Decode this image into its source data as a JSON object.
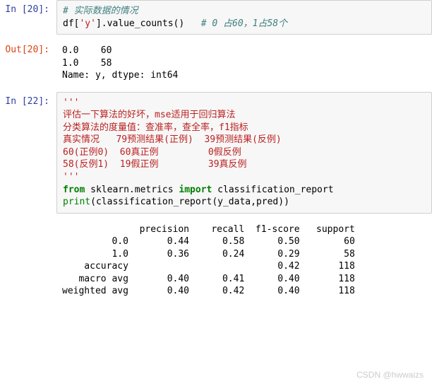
{
  "cells": {
    "c20": {
      "prompt_in": "In  [20]:",
      "prompt_out": "Out[20]:",
      "line1_comment": "# 实际数据的情况",
      "line2_code": "df[",
      "line2_str": "'y'",
      "line2_rest": "].value_counts()   ",
      "line2_trail_comment": "# 0 占60，1占58个",
      "out_line1": "0.0    60",
      "out_line2": "1.0    58",
      "out_line3": "Name: y, dtype: int64"
    },
    "c22": {
      "prompt_in": "In  [22]:",
      "docstring_open": "'''",
      "doc_l1": "评估一下算法的好坏，mse适用于回归算法",
      "doc_l2": "分类算法的度量值：查准率，查全率，f1指标",
      "doc_l3": "",
      "doc_l4": "真实情况   79预测结果(正例)  39预测结果(反例)",
      "doc_l5": "60(正例0)  60真正例         0假反例",
      "doc_l6": "58(反例1)  19假正例         39真反例",
      "docstring_close": "'''",
      "kw_from": "from",
      "mod": " sklearn.metrics ",
      "kw_import": "import",
      "imp": " classification_report",
      "print": "print",
      "call": "(classification_report(y_data,pred))",
      "report_header": "              precision    recall  f1-score   support",
      "report_blank1": "",
      "report_r1": "         0.0       0.44      0.58      0.50        60",
      "report_r2": "         1.0       0.36      0.24      0.29        58",
      "report_blank2": "",
      "report_acc": "    accuracy                           0.42       118",
      "report_mac": "   macro avg       0.40      0.41      0.40       118",
      "report_wgt": "weighted avg       0.40      0.42      0.40       118"
    }
  },
  "chart_data": [
    {
      "type": "table",
      "title": "value_counts",
      "categories": [
        "0.0",
        "1.0"
      ],
      "values": [
        60,
        58
      ]
    },
    {
      "type": "table",
      "title": "classification_report",
      "columns": [
        "precision",
        "recall",
        "f1-score",
        "support"
      ],
      "rows": [
        {
          "label": "0.0",
          "values": [
            0.44,
            0.58,
            0.5,
            60
          ]
        },
        {
          "label": "1.0",
          "values": [
            0.36,
            0.24,
            0.29,
            58
          ]
        },
        {
          "label": "accuracy",
          "values": [
            null,
            null,
            0.42,
            118
          ]
        },
        {
          "label": "macro avg",
          "values": [
            0.4,
            0.41,
            0.4,
            118
          ]
        },
        {
          "label": "weighted avg",
          "values": [
            0.4,
            0.42,
            0.4,
            118
          ]
        }
      ]
    }
  ],
  "watermark": "CSDN @hwwaizs"
}
